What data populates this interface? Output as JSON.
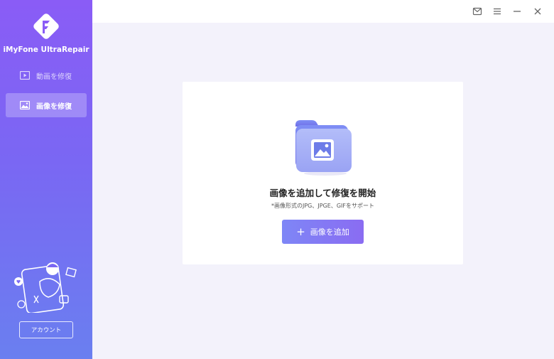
{
  "app": {
    "name": "iMyFone UltraRepair"
  },
  "sidebar": {
    "items": [
      {
        "label": "動画を修復",
        "icon": "video-icon",
        "active": false
      },
      {
        "label": "画像を修復",
        "icon": "image-icon",
        "active": true
      }
    ],
    "account_label": "アカウント"
  },
  "titlebar": {
    "icons": [
      "mail-icon",
      "menu-icon",
      "minimize-icon",
      "close-icon"
    ]
  },
  "main": {
    "title": "画像を追加して修復を開始",
    "subtitle": "*画像形式のJPG、JPGE、GIFをサポート",
    "add_button_label": "画像を追加",
    "add_button_icon": "plus-icon"
  },
  "colors": {
    "sidebar_top": "#8a5cf6",
    "sidebar_bottom": "#6a7ff0",
    "accent": "#7e86f6",
    "background": "#f3f2fb"
  }
}
